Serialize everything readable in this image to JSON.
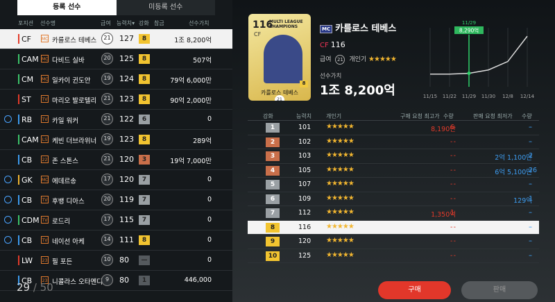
{
  "tabs": {
    "registered": "등록 선수",
    "unregistered": "미등록 선수"
  },
  "columns": {
    "position": "포지션",
    "name": "선수명",
    "grade": "급여",
    "ovr": "능력치▾",
    "level": "강화",
    "ref": "참금",
    "value": "선수가치"
  },
  "players": [
    {
      "pos": "CF",
      "team": "MC",
      "name": "카를로스 테베스",
      "grade": "21",
      "ovr": "127",
      "lvl": "8",
      "value": "1조 8,200억",
      "timer": false,
      "pos_color": "#e23a2a",
      "lvl_color": "#f2c430",
      "selected": true
    },
    {
      "pos": "CAM",
      "team": "MC",
      "name": "다비드 실바",
      "grade": "20",
      "ovr": "125",
      "lvl": "8",
      "value": "507억",
      "timer": false,
      "pos_color": "#3cc46a",
      "lvl_color": "#f2c430"
    },
    {
      "pos": "CM",
      "team": "MC",
      "name": "일카이 귄도안",
      "grade": "19",
      "ovr": "124",
      "lvl": "8",
      "value": "79억 6,000만",
      "timer": false,
      "pos_color": "#3cc46a",
      "lvl_color": "#f2c430"
    },
    {
      "pos": "ST",
      "team": "TV",
      "name": "마리오 발로텔리",
      "grade": "21",
      "ovr": "123",
      "lvl": "8",
      "value": "90억 2,000만",
      "timer": false,
      "pos_color": "#e23a2a",
      "lvl_color": "#f2c430"
    },
    {
      "pos": "RB",
      "team": "TV",
      "name": "카일 워커",
      "grade": "21",
      "ovr": "122",
      "lvl": "6",
      "value": "0",
      "timer": true,
      "pos_color": "#3d9cf0",
      "lvl_color": "#9aa0a4"
    },
    {
      "pos": "CAM",
      "team": "LS",
      "name": "케빈 더브라위너",
      "grade": "19",
      "ovr": "123",
      "lvl": "8",
      "value": "289억",
      "timer": false,
      "pos_color": "#3cc46a",
      "lvl_color": "#f2c430"
    },
    {
      "pos": "CB",
      "team": "22",
      "name": "존 스톤스",
      "grade": "21",
      "ovr": "120",
      "lvl": "3",
      "value": "19억 7,000만",
      "timer": false,
      "pos_color": "#3d9cf0",
      "lvl_color": "#c96f4a"
    },
    {
      "pos": "GK",
      "team": "MC",
      "name": "에데르송",
      "grade": "17",
      "ovr": "120",
      "lvl": "7",
      "value": "0",
      "timer": true,
      "pos_color": "#f2b630",
      "lvl_color": "#9aa0a4"
    },
    {
      "pos": "CB",
      "team": "TV",
      "name": "후뱅 디아스",
      "grade": "20",
      "ovr": "119",
      "lvl": "7",
      "value": "0",
      "timer": true,
      "pos_color": "#3d9cf0",
      "lvl_color": "#9aa0a4"
    },
    {
      "pos": "CDM",
      "team": "TV",
      "name": "로드리",
      "grade": "17",
      "ovr": "115",
      "lvl": "7",
      "value": "0",
      "timer": true,
      "pos_color": "#3cc46a",
      "lvl_color": "#9aa0a4"
    },
    {
      "pos": "CB",
      "team": "TV",
      "name": "네이선 아케",
      "grade": "14",
      "ovr": "111",
      "lvl": "8",
      "value": "0",
      "timer": true,
      "pos_color": "#3d9cf0",
      "lvl_color": "#f2c430"
    },
    {
      "pos": "LW",
      "team": "23",
      "name": "필 포든",
      "grade": "10",
      "ovr": "80",
      "lvl": "—",
      "value": "0",
      "timer": false,
      "pos_color": "#e23a2a",
      "lvl_color": "#555a5e"
    },
    {
      "pos": "CB",
      "team": "23",
      "name": "니콜라스 오타멘디",
      "grade": "9",
      "ovr": "80",
      "lvl": "1",
      "value": "446,000",
      "timer": false,
      "pos_color": "#3d9cf0",
      "lvl_color": "#555a5e"
    }
  ],
  "count": {
    "current": "29",
    "max": "/ 50"
  },
  "detail": {
    "card_ovr": "116",
    "card_pos": "CF",
    "card_title": "MULTI LEAGUE CHAMPIONS",
    "card_name": "카를로스 테베스",
    "card_grade": "21",
    "card_lvl": "8",
    "team_badge": "MC",
    "name": "카를로스 테베스",
    "pos": "CF",
    "ovr": "116",
    "grade_label": "급여",
    "grade": "21",
    "popularity_label": "개인기",
    "stars": "★★★★★",
    "value_label": "선수가치",
    "value": "1조 8,200억"
  },
  "chart_data": {
    "type": "line",
    "x": [
      "11/15",
      "11/22",
      "11/29",
      "11/30",
      "12/8",
      "12/14"
    ],
    "highlight_date": "11/29",
    "highlight_value": "8,290억",
    "series": [
      {
        "values": [
          15,
          15,
          16,
          20,
          30,
          60
        ]
      }
    ]
  },
  "table": {
    "headers": {
      "lvl": "강화",
      "ovr": "능력치",
      "stars": "개인기",
      "buy_price": "구매 요청 최고가",
      "buy_qty": "수량",
      "sell_price": "판매 요청 최저가",
      "sell_qty": "수량"
    },
    "rows": [
      {
        "lvl": "1",
        "ovr": "101",
        "stars": "★★★★★",
        "bp": "8,190만",
        "bq": "6",
        "sp": "-",
        "sq": "-",
        "lc": "#9aa0a4"
      },
      {
        "lvl": "2",
        "ovr": "102",
        "stars": "★★★★★",
        "bp": "-",
        "bq": "-",
        "sp": "-",
        "sq": "-",
        "lc": "#c96f4a"
      },
      {
        "lvl": "3",
        "ovr": "103",
        "stars": "★★★★★",
        "bp": "-",
        "bq": "-",
        "sp": "2억 1,100만",
        "sq": "2",
        "lc": "#c96f4a"
      },
      {
        "lvl": "4",
        "ovr": "105",
        "stars": "★★★★★",
        "bp": "-",
        "bq": "-",
        "sp": "6억 5,100만",
        "sq": "26",
        "lc": "#c96f4a"
      },
      {
        "lvl": "5",
        "ovr": "107",
        "stars": "★★★★★",
        "bp": "-",
        "bq": "-",
        "sp": "-",
        "sq": "-",
        "lc": "#9aa0a4"
      },
      {
        "lvl": "6",
        "ovr": "109",
        "stars": "★★★★★",
        "bp": "-",
        "bq": "-",
        "sp": "129억",
        "sq": "1",
        "lc": "#9aa0a4"
      },
      {
        "lvl": "7",
        "ovr": "112",
        "stars": "★★★★★",
        "bp": "1,350억",
        "bq": "1",
        "sp": "-",
        "sq": "-",
        "lc": "#9aa0a4"
      },
      {
        "lvl": "8",
        "ovr": "116",
        "stars": "★★★★★",
        "bp": "-",
        "bq": "-",
        "sp": "-",
        "sq": "-",
        "lc": "#f2c430",
        "selected": true
      },
      {
        "lvl": "9",
        "ovr": "120",
        "stars": "★★★★★",
        "bp": "-",
        "bq": "-",
        "sp": "-",
        "sq": "-",
        "lc": "#f2c430"
      },
      {
        "lvl": "10",
        "ovr": "125",
        "stars": "★★★★★",
        "bp": "-",
        "bq": "-",
        "sp": "-",
        "sq": "-",
        "lc": "#f2c430"
      }
    ]
  },
  "buttons": {
    "buy": "구매",
    "sell": "판매"
  }
}
